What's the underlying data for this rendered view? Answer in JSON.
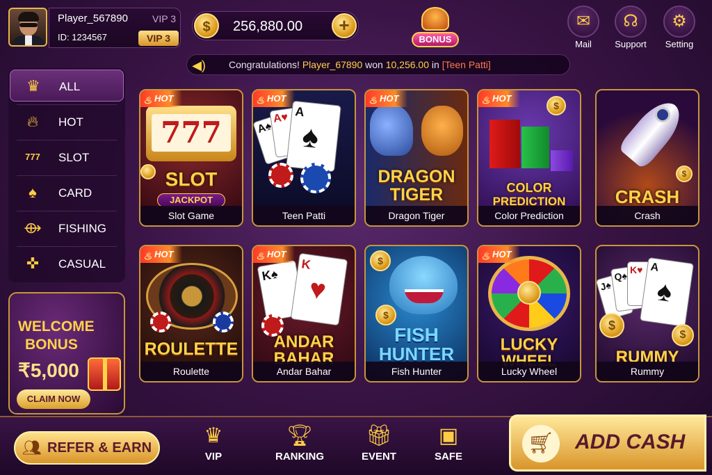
{
  "player": {
    "name": "Player_567890",
    "vip_small": "VIP 3",
    "id": "ID: 1234567",
    "vip_badge": "VIP 3"
  },
  "balance": {
    "currency_icon": "$",
    "value": "256,880.00",
    "plus": "+"
  },
  "bonus": {
    "label": "BONUS"
  },
  "top_actions": [
    {
      "label": "Mail",
      "icon": "mail-icon"
    },
    {
      "label": "Support",
      "icon": "headset-icon"
    },
    {
      "label": "Setting",
      "icon": "gear-icon"
    }
  ],
  "ticker": {
    "prefix": "Congratulations!",
    "player": "Player_67890",
    "won_text": "won",
    "amount": "10,256.00",
    "in_text": "in",
    "game": "[Teen Patti]"
  },
  "sidebar": {
    "items": [
      {
        "label": "ALL",
        "icon": "crown-icon",
        "active": true
      },
      {
        "label": "HOT",
        "icon": "flame-icon",
        "active": false
      },
      {
        "label": "SLOT",
        "icon": "slot-777-icon",
        "active": false
      },
      {
        "label": "CARD",
        "icon": "cards-icon",
        "active": false
      },
      {
        "label": "FISHING",
        "icon": "fish-icon",
        "active": false
      },
      {
        "label": "CASUAL",
        "icon": "gamepad-icon",
        "active": false
      }
    ]
  },
  "welcome": {
    "title_line1": "WELCOME",
    "title_line2": "BONUS",
    "amount": "₹5,000",
    "claim": "CLAIM NOW"
  },
  "games": [
    {
      "name": "Slot Game",
      "art_title": "SLOT",
      "art_sub": "JACKPOT",
      "art_reels": "777",
      "hot": true
    },
    {
      "name": "Teen Patti",
      "art_title": "",
      "hot": true
    },
    {
      "name": "Dragon Tiger",
      "art_title": "DRAGON",
      "art_title2": "TIGER",
      "hot": true
    },
    {
      "name": "Color Prediction",
      "art_title": "COLOR",
      "art_title2": "PREDICTION",
      "hot": true
    },
    {
      "name": "Crash",
      "art_title": "CRASH",
      "hot": false
    },
    {
      "name": "Roulette",
      "art_title": "ROULETTE",
      "hot": true
    },
    {
      "name": "Andar Bahar",
      "art_title": "ANDAR",
      "art_title2": "BAHAR",
      "hot": true
    },
    {
      "name": "Fish Hunter",
      "art_title": "FISH",
      "art_title2": "HUNTER",
      "hot": false
    },
    {
      "name": "Lucky Wheel",
      "art_title": "LUCKY",
      "art_title2": "WHEEL",
      "hot": true
    },
    {
      "name": "Rummy",
      "art_title": "RUMMY",
      "hot": false
    }
  ],
  "hot_label": "HOT",
  "bottom": {
    "refer": "REFER & EARN",
    "nav": [
      {
        "label": "VIP",
        "icon": "crown-icon"
      },
      {
        "label": "RANKING",
        "icon": "trophy-icon"
      },
      {
        "label": "EVENT",
        "icon": "gift-icon"
      },
      {
        "label": "SAFE",
        "icon": "safe-icon"
      }
    ],
    "add_cash": "ADD CASH"
  }
}
